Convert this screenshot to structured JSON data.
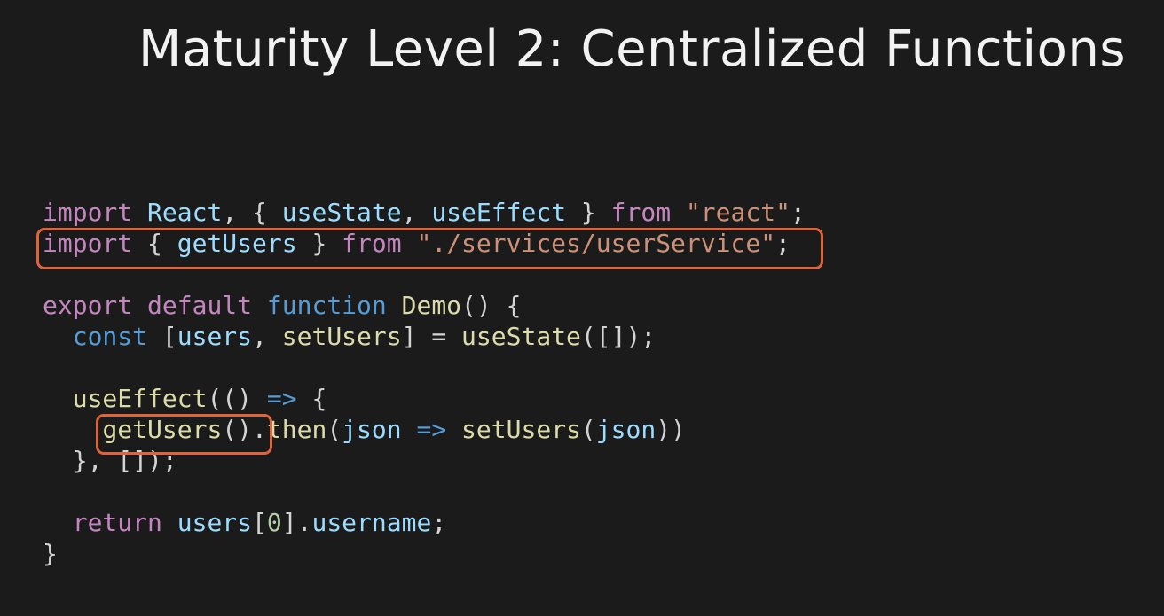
{
  "slide": {
    "title": "Maturity Level 2: Centralized Functions"
  },
  "code": {
    "l1": {
      "import": "import",
      "react": "React",
      "brace_open": ", { ",
      "useState": "useState",
      "comma": ", ",
      "useEffect": "useEffect",
      "brace_close": " } ",
      "from": "from",
      "space": " ",
      "module": "\"react\"",
      "semi": ";"
    },
    "l2": {
      "import": "import",
      "brace_open": " { ",
      "getUsers": "getUsers",
      "brace_close": " } ",
      "from": "from",
      "space": " ",
      "module": "\"./services/userService\"",
      "semi": ";"
    },
    "l4": {
      "export": "export",
      "default": "default",
      "function": "function",
      "name": "Demo",
      "rest": "() {"
    },
    "l5": {
      "indent": "  ",
      "const": "const",
      "bracket_open": " [",
      "users": "users",
      "comma": ", ",
      "setUsers": "setUsers",
      "bracket_close": "] = ",
      "useState": "useState",
      "rest": "([]);"
    },
    "l7": {
      "indent": "  ",
      "useEffect": "useEffect",
      "paren": "(() ",
      "arrow": "=>",
      "rest": " {"
    },
    "l8": {
      "indent": "    ",
      "getUsers": "getUsers",
      "parens": "().",
      "then": "then",
      "paren_open": "(",
      "json": "json",
      "space": " ",
      "arrow": "=>",
      "space2": " ",
      "setUsers": "setUsers",
      "paren_open2": "(",
      "json2": "json",
      "rest": "))"
    },
    "l9": {
      "text": "  }, []);"
    },
    "l11": {
      "indent": "  ",
      "return": "return",
      "space": " ",
      "users": "users",
      "bracket_open": "[",
      "zero": "0",
      "bracket_close": "].",
      "username": "username",
      "semi": ";"
    },
    "l12": {
      "text": "}"
    }
  },
  "highlight_color": "#e0643a"
}
